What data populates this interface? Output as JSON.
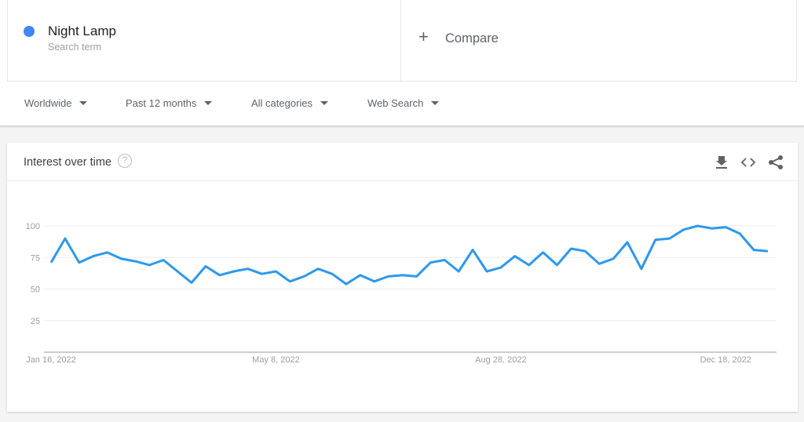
{
  "search_term": {
    "name": "Night Lamp",
    "subtitle": "Search term",
    "color": "#4285f4"
  },
  "compare": {
    "icon": "plus-icon",
    "label": "Compare"
  },
  "filters": [
    {
      "label": "Worldwide",
      "icon": "caret-down-icon"
    },
    {
      "label": "Past 12 months",
      "icon": "caret-down-icon"
    },
    {
      "label": "All categories",
      "icon": "caret-down-icon"
    },
    {
      "label": "Web Search",
      "icon": "caret-down-icon"
    }
  ],
  "card": {
    "title": "Interest over time",
    "help_icon": "help-circle-icon",
    "help_glyph": "?",
    "actions": [
      "download-icon",
      "embed-code-icon",
      "share-icon"
    ]
  },
  "chart_data": {
    "type": "line",
    "title": "Interest over time",
    "xlabel": "",
    "ylabel": "",
    "ylim": [
      0,
      100
    ],
    "yticks": [
      25,
      50,
      75,
      100
    ],
    "ytick_labels": [
      "25",
      "50",
      "75",
      "100"
    ],
    "grid": true,
    "x_start": "Jan 16, 2022",
    "x_interval": "weekly",
    "xtick_labels": [
      {
        "label": "Jan 16, 2022",
        "index": 0
      },
      {
        "label": "May 8, 2022",
        "index": 16
      },
      {
        "label": "Aug 28, 2022",
        "index": 32
      },
      {
        "label": "Dec 18, 2022",
        "index": 48
      }
    ],
    "series": [
      {
        "name": "Night Lamp",
        "color": "#2d98ed",
        "values": [
          71,
          90,
          71,
          76,
          79,
          74,
          72,
          69,
          73,
          64,
          55,
          68,
          61,
          64,
          66,
          62,
          64,
          56,
          60,
          66,
          62,
          54,
          61,
          56,
          60,
          61,
          60,
          71,
          73,
          64,
          81,
          64,
          67,
          76,
          69,
          79,
          69,
          82,
          80,
          70,
          74,
          87,
          66,
          89,
          90,
          97,
          100,
          98,
          99,
          94,
          81,
          80
        ]
      }
    ]
  }
}
